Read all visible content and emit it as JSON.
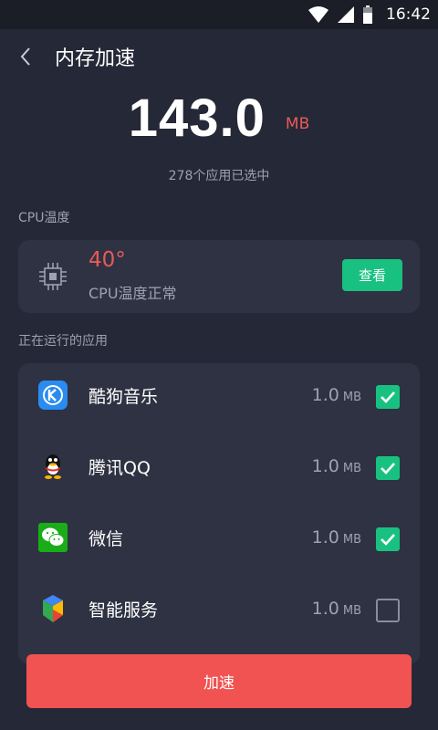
{
  "status_bar": {
    "time": "16:42"
  },
  "header": {
    "title": "内存加速"
  },
  "memory": {
    "value": "143.0",
    "unit": "MB",
    "selected_text": "278个应用已选中"
  },
  "cpu": {
    "section_label": "CPU温度",
    "temperature": "40°",
    "status_text": "CPU温度正常",
    "view_button": "查看"
  },
  "running_apps": {
    "section_label": "正在运行的应用",
    "items": [
      {
        "name": "酷狗音乐",
        "size": "1.0",
        "unit": "MB",
        "checked": true,
        "icon": "kugou-icon"
      },
      {
        "name": "腾讯QQ",
        "size": "1.0",
        "unit": "MB",
        "checked": true,
        "icon": "qq-icon"
      },
      {
        "name": "微信",
        "size": "1.0",
        "unit": "MB",
        "checked": true,
        "icon": "wechat-icon"
      },
      {
        "name": "智能服务",
        "size": "1.0",
        "unit": "MB",
        "checked": false,
        "icon": "smart-service-icon"
      }
    ]
  },
  "accelerate_button": "加速",
  "colors": {
    "background": "#252836",
    "card": "#2f3242",
    "accent_green": "#19c181",
    "accent_red": "#f05351"
  }
}
